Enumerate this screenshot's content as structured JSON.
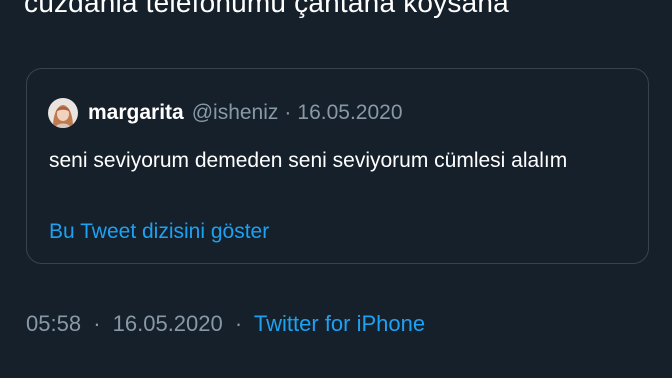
{
  "tweet": {
    "text_fragment": "cüzdanla telefonumu çantana koysana",
    "time": "05:58",
    "separator": "·",
    "date": "16.05.2020",
    "source": "Twitter for iPhone"
  },
  "quoted_tweet": {
    "display_name": "margarita",
    "handle": "@isheniz",
    "separator": "·",
    "date": "16.05.2020",
    "text": "seni seviyorum demeden seni seviyorum cümlesi alalım",
    "show_thread_label": "Bu Tweet dizisini göster"
  },
  "colors": {
    "background": "#15202b",
    "border": "#38444d",
    "secondary_text": "#8899a6",
    "link": "#1da1f2",
    "primary_text": "#ffffff"
  }
}
